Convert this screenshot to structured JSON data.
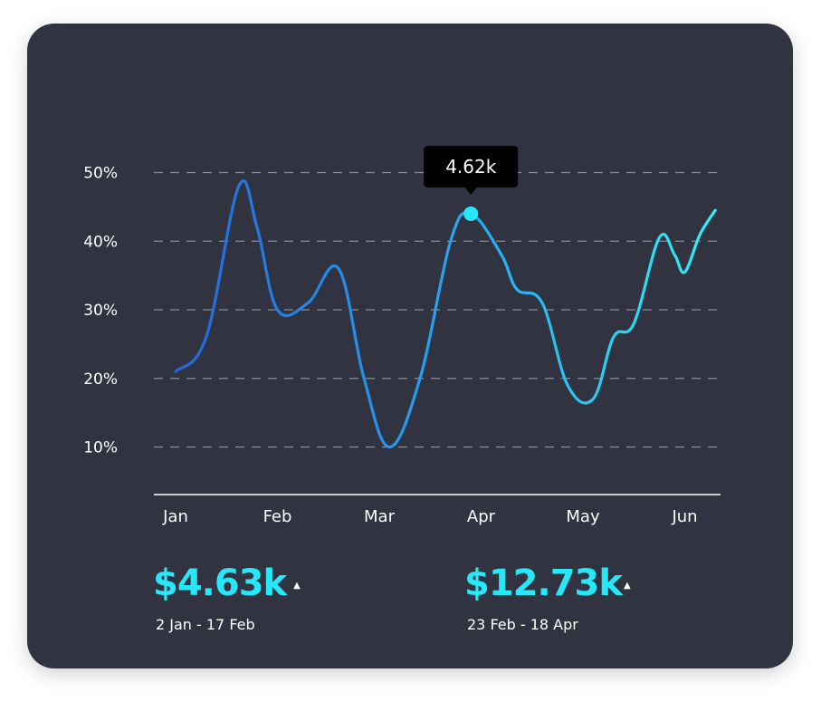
{
  "colors": {
    "card_bg": "#313341",
    "line_start": "#2264dc",
    "line_end": "#2ff0f7",
    "accent": "#27e8f8",
    "grid": "#8a8c96",
    "tooltip_bg": "#000000",
    "text": "#ffffff"
  },
  "chart_data": {
    "type": "line",
    "categories": [
      "Jan",
      "Feb",
      "Mar",
      "Apr",
      "May",
      "Jun"
    ],
    "y_ticks": [
      "10%",
      "20%",
      "30%",
      "40%",
      "50%"
    ],
    "ylim": [
      0,
      50
    ],
    "grid": true,
    "series": [
      {
        "values": [
          [
            0,
            21
          ],
          [
            0.3,
            26
          ],
          [
            0.62,
            48
          ],
          [
            0.8,
            42
          ],
          [
            1.0,
            30
          ],
          [
            1.3,
            31
          ],
          [
            1.6,
            36
          ],
          [
            1.85,
            20
          ],
          [
            2.1,
            10
          ],
          [
            2.4,
            20
          ],
          [
            2.7,
            40
          ],
          [
            2.9,
            44
          ],
          [
            3.2,
            38
          ],
          [
            3.35,
            33
          ],
          [
            3.6,
            31
          ],
          [
            3.85,
            19
          ],
          [
            4.1,
            17
          ],
          [
            4.3,
            26
          ],
          [
            4.5,
            28
          ],
          [
            4.75,
            40.5
          ],
          [
            4.9,
            38
          ],
          [
            5.0,
            35.5
          ],
          [
            5.15,
            41
          ],
          [
            5.3,
            44.5
          ]
        ]
      }
    ],
    "tooltip": {
      "label": "4.62k",
      "x": 2.9,
      "y": 44
    }
  },
  "stats": [
    {
      "value": "$4.63k",
      "arrow": "▲",
      "range": "2 Jan - 17 Feb"
    },
    {
      "value": "$12.73k",
      "arrow": "▲",
      "range": "23 Feb - 18 Apr"
    }
  ]
}
